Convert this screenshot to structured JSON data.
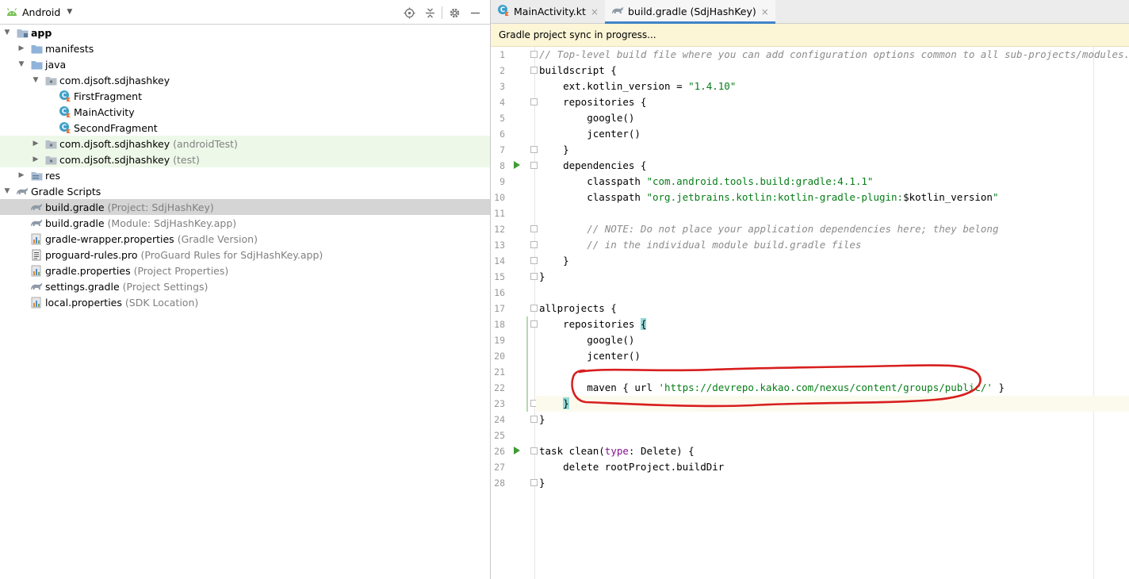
{
  "project_panel": {
    "view_name": "Android",
    "tree": [
      {
        "label": "app",
        "hint": "",
        "bold": true,
        "arrow": "down",
        "level": 0,
        "icon": "module-folder-icon",
        "bg": ""
      },
      {
        "label": "manifests",
        "hint": "",
        "arrow": "right",
        "level": 1,
        "icon": "folder-icon",
        "bg": ""
      },
      {
        "label": "java",
        "hint": "",
        "arrow": "down",
        "level": 1,
        "icon": "folder-icon",
        "bg": ""
      },
      {
        "label": "com.djsoft.sdjhashkey",
        "hint": "",
        "arrow": "down",
        "level": 2,
        "icon": "package-icon",
        "bg": ""
      },
      {
        "label": "FirstFragment",
        "hint": "",
        "arrow": "none",
        "level": 3,
        "icon": "kotlin-class-icon",
        "bg": ""
      },
      {
        "label": "MainActivity",
        "hint": "",
        "arrow": "none",
        "level": 3,
        "icon": "kotlin-class-icon",
        "bg": ""
      },
      {
        "label": "SecondFragment",
        "hint": "",
        "arrow": "none",
        "level": 3,
        "icon": "kotlin-class-icon",
        "bg": ""
      },
      {
        "label": "com.djsoft.sdjhashkey",
        "hint": "(androidTest)",
        "arrow": "right",
        "level": 2,
        "icon": "package-icon",
        "bg": "green"
      },
      {
        "label": "com.djsoft.sdjhashkey",
        "hint": "(test)",
        "arrow": "right",
        "level": 2,
        "icon": "package-icon",
        "bg": "green"
      },
      {
        "label": "res",
        "hint": "",
        "arrow": "right",
        "level": 1,
        "icon": "res-folder-icon",
        "bg": ""
      },
      {
        "label": "Gradle Scripts",
        "hint": "",
        "arrow": "down",
        "level": 0,
        "icon": "gradle-icon",
        "bg": ""
      },
      {
        "label": "build.gradle",
        "hint": "(Project: SdjHashKey)",
        "arrow": "none",
        "level": 1,
        "icon": "gradle-icon",
        "bg": "sel"
      },
      {
        "label": "build.gradle",
        "hint": "(Module: SdjHashKey.app)",
        "arrow": "none",
        "level": 1,
        "icon": "gradle-icon",
        "bg": ""
      },
      {
        "label": "gradle-wrapper.properties",
        "hint": "(Gradle Version)",
        "arrow": "none",
        "level": 1,
        "icon": "properties-icon",
        "bg": ""
      },
      {
        "label": "proguard-rules.pro",
        "hint": "(ProGuard Rules for SdjHashKey.app)",
        "arrow": "none",
        "level": 1,
        "icon": "text-file-icon",
        "bg": ""
      },
      {
        "label": "gradle.properties",
        "hint": "(Project Properties)",
        "arrow": "none",
        "level": 1,
        "icon": "properties-icon",
        "bg": ""
      },
      {
        "label": "settings.gradle",
        "hint": "(Project Settings)",
        "arrow": "none",
        "level": 1,
        "icon": "gradle-icon",
        "bg": ""
      },
      {
        "label": "local.properties",
        "hint": "(SDK Location)",
        "arrow": "none",
        "level": 1,
        "icon": "properties-icon",
        "bg": ""
      }
    ]
  },
  "editor": {
    "tabs": [
      {
        "label": "MainActivity.kt",
        "icon": "kotlin-class-icon",
        "active": false
      },
      {
        "label": "build.gradle (SdjHashKey)",
        "icon": "gradle-icon",
        "active": true
      }
    ],
    "banner": "Gradle project sync in progress...",
    "lines": [
      {
        "n": "1",
        "run": false,
        "fold": true,
        "caret": false,
        "tokens": [
          [
            "cm",
            "// Top-level build file where you can add configuration options common to all sub-projects/modules."
          ]
        ]
      },
      {
        "n": "2",
        "run": false,
        "fold": true,
        "caret": false,
        "tokens": [
          [
            "",
            "buildscript {"
          ]
        ]
      },
      {
        "n": "3",
        "run": false,
        "fold": false,
        "caret": false,
        "tokens": [
          [
            "",
            "    ext.kotlin_version = "
          ],
          [
            "str",
            "\"1.4.10\""
          ]
        ]
      },
      {
        "n": "4",
        "run": false,
        "fold": true,
        "caret": false,
        "tokens": [
          [
            "",
            "    repositories {"
          ]
        ]
      },
      {
        "n": "5",
        "run": false,
        "fold": false,
        "caret": false,
        "tokens": [
          [
            "",
            "        google()"
          ]
        ]
      },
      {
        "n": "6",
        "run": false,
        "fold": false,
        "caret": false,
        "tokens": [
          [
            "",
            "        jcenter()"
          ]
        ]
      },
      {
        "n": "7",
        "run": false,
        "fold": true,
        "caret": false,
        "tokens": [
          [
            "",
            "    }"
          ]
        ]
      },
      {
        "n": "8",
        "run": true,
        "fold": true,
        "caret": false,
        "tokens": [
          [
            "",
            "    dependencies {"
          ]
        ]
      },
      {
        "n": "9",
        "run": false,
        "fold": false,
        "caret": false,
        "tokens": [
          [
            "",
            "        classpath "
          ],
          [
            "str",
            "\"com.android.tools.build:gradle:4.1.1\""
          ]
        ]
      },
      {
        "n": "10",
        "run": false,
        "fold": false,
        "caret": false,
        "tokens": [
          [
            "",
            "        classpath "
          ],
          [
            "str",
            "\"org.jetbrains.kotlin:kotlin-gradle-plugin:"
          ],
          [
            "",
            "$kotlin_version"
          ],
          [
            "str",
            "\""
          ]
        ]
      },
      {
        "n": "11",
        "run": false,
        "fold": false,
        "caret": false,
        "tokens": [
          [
            "",
            ""
          ]
        ]
      },
      {
        "n": "12",
        "run": false,
        "fold": true,
        "caret": false,
        "tokens": [
          [
            "cm",
            "        // NOTE: Do not place your application dependencies here; they belong"
          ]
        ]
      },
      {
        "n": "13",
        "run": false,
        "fold": true,
        "caret": false,
        "tokens": [
          [
            "cm",
            "        // in the individual module build.gradle files"
          ]
        ]
      },
      {
        "n": "14",
        "run": false,
        "fold": true,
        "caret": false,
        "tokens": [
          [
            "",
            "    }"
          ]
        ]
      },
      {
        "n": "15",
        "run": false,
        "fold": true,
        "caret": false,
        "tokens": [
          [
            "",
            "}"
          ]
        ]
      },
      {
        "n": "16",
        "run": false,
        "fold": false,
        "caret": false,
        "tokens": [
          [
            "",
            ""
          ]
        ]
      },
      {
        "n": "17",
        "run": false,
        "fold": true,
        "caret": false,
        "tokens": [
          [
            "",
            "allprojects {"
          ]
        ]
      },
      {
        "n": "18",
        "run": false,
        "fold": true,
        "caret": false,
        "tokens": [
          [
            "",
            "    repositories "
          ],
          [
            "brace-hl",
            "{"
          ]
        ]
      },
      {
        "n": "19",
        "run": false,
        "fold": false,
        "caret": false,
        "tokens": [
          [
            "",
            "        google()"
          ]
        ]
      },
      {
        "n": "20",
        "run": false,
        "fold": false,
        "caret": false,
        "tokens": [
          [
            "",
            "        jcenter()"
          ]
        ]
      },
      {
        "n": "21",
        "run": false,
        "fold": false,
        "caret": false,
        "tokens": [
          [
            "",
            ""
          ]
        ]
      },
      {
        "n": "22",
        "run": false,
        "fold": false,
        "caret": false,
        "tokens": [
          [
            "",
            "        maven { url "
          ],
          [
            "str",
            "'https://devrepo.kakao.com/nexus/content/groups/public/'"
          ],
          [
            "",
            " }"
          ]
        ]
      },
      {
        "n": "23",
        "run": false,
        "fold": true,
        "caret": true,
        "tokens": [
          [
            "",
            "    "
          ],
          [
            "brace-hl",
            "}"
          ]
        ]
      },
      {
        "n": "24",
        "run": false,
        "fold": true,
        "caret": false,
        "tokens": [
          [
            "",
            "}"
          ]
        ]
      },
      {
        "n": "25",
        "run": false,
        "fold": false,
        "caret": false,
        "tokens": [
          [
            "",
            ""
          ]
        ]
      },
      {
        "n": "26",
        "run": true,
        "fold": true,
        "caret": false,
        "tokens": [
          [
            "",
            "task clean("
          ],
          [
            "kw",
            "type"
          ],
          [
            "",
            ": Delete) {"
          ]
        ]
      },
      {
        "n": "27",
        "run": false,
        "fold": false,
        "caret": false,
        "tokens": [
          [
            "",
            "    delete rootProject.buildDir"
          ]
        ]
      },
      {
        "n": "28",
        "run": false,
        "fold": true,
        "caret": false,
        "tokens": [
          [
            "",
            "}"
          ]
        ]
      }
    ]
  },
  "colors": {
    "annotation_circle": "#d81e1e",
    "active_tab_underline": "#4083c9",
    "banner_background": "#fcf5d6",
    "string": "#067d17",
    "comment": "#8c8c8c"
  }
}
